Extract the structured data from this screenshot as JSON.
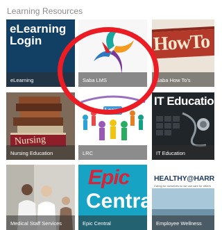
{
  "section_title": "Learning Resources",
  "tiles": {
    "elearning": {
      "heading_line1": "eLearning",
      "heading_line2": "Login",
      "caption": "eLearning"
    },
    "saba": {
      "caption": "Saba LMS"
    },
    "howto": {
      "banner_text": "HowTo",
      "caption": "Saba How To's"
    },
    "nursing": {
      "book_label": "Nursing",
      "caption": "Nursing Education"
    },
    "lrc": {
      "sign_text": "Learn",
      "caption": "LRC"
    },
    "it": {
      "heading": "IT Education",
      "caption": "IT Education"
    },
    "medical": {
      "caption": "Medical Staff Services"
    },
    "epic": {
      "word1": "Epic",
      "word2": "Central",
      "caption": "Epic Central"
    },
    "wellness": {
      "brand": "HEALTHY@HARRIS",
      "tagline": "Caring for ourselves so we can care for others",
      "caption": "Employee Wellness"
    }
  },
  "colors": {
    "highlight": "#ec1c24",
    "elearning_bg": "#123f64",
    "epic_bg": "#17a3c4",
    "epic_red": "#d6243b",
    "wellness_navy": "#1f3a66"
  }
}
